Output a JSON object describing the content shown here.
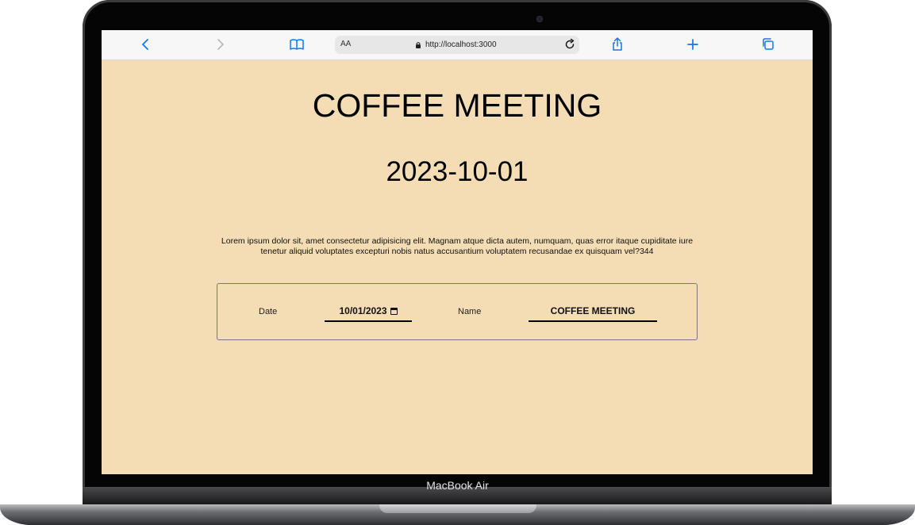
{
  "device": {
    "label": "MacBook Air"
  },
  "browser": {
    "url": "http://localhost:3000",
    "text_size_control": "AA",
    "accent_color": "#1677e8",
    "icons": {
      "back": "chevron-left-icon",
      "forward": "chevron-right-icon",
      "bookmarks": "book-icon",
      "lock": "lock-icon",
      "reload": "reload-icon",
      "share": "share-icon",
      "new_tab": "plus-icon",
      "tabs": "tabs-icon"
    }
  },
  "page": {
    "background_color": "#f4ddb4",
    "title": "COFFEE MEETING",
    "date": "2023-10-01",
    "description": "Lorem ipsum dolor sit, amet consectetur adipisicing elit. Magnam atque dicta autem, numquam, quas error itaque cupiditate iure tenetur aliquid voluptates excepturi nobis natus accusantium voluptatem recusandae ex quisquam vel?344"
  },
  "form": {
    "date_label": "Date",
    "date_value": "10/01/2023",
    "name_label": "Name",
    "name_value": "COFFEE MEETING"
  }
}
